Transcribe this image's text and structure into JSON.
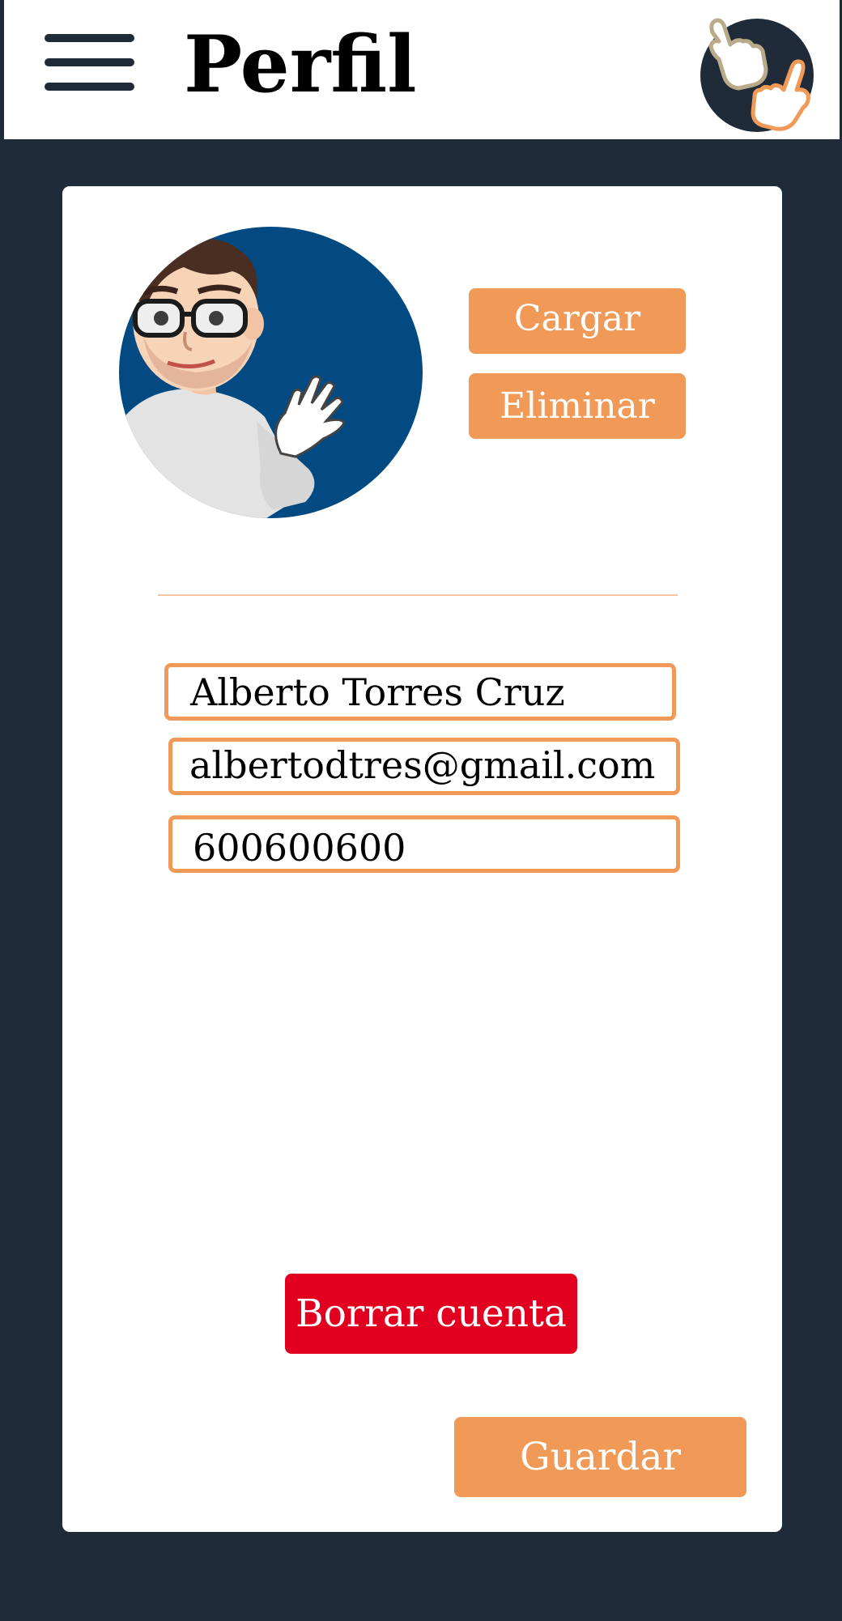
{
  "header": {
    "menu_icon": "hamburger-menu-icon",
    "title": "Perfil",
    "logo_icon": "pointing-hands-logo"
  },
  "profile": {
    "avatar_icon": "cartoon-avatar-waving",
    "upload_label": "Cargar",
    "delete_photo_label": "Eliminar"
  },
  "form": {
    "name_value": "Alberto Torres Cruz",
    "email_value": "albertodtres@gmail.com",
    "phone_value": "600600600"
  },
  "actions": {
    "delete_account_label": "Borrar cuenta",
    "save_label": "Guardar"
  },
  "colors": {
    "background": "#202b39",
    "accent": "#f19957",
    "danger": "#e1001f",
    "avatar_bg": "#034a82"
  }
}
